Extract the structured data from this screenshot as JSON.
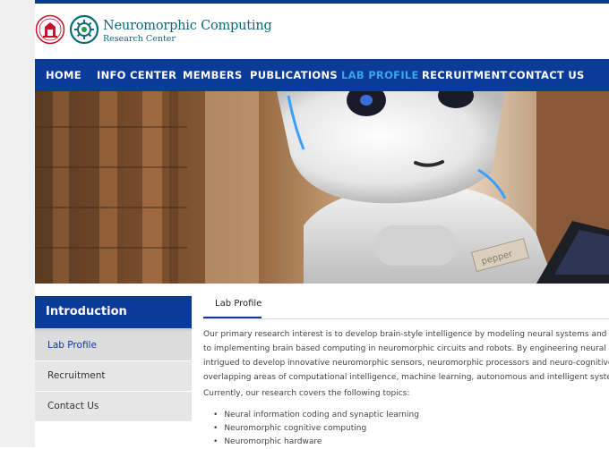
{
  "brand": {
    "title": "Neuromorphic Computing",
    "subtitle": "Research Center"
  },
  "nav": {
    "items": [
      {
        "label": "HOME"
      },
      {
        "label": "INFO CENTER"
      },
      {
        "label": "MEMBERS"
      },
      {
        "label": "PUBLICATIONS"
      },
      {
        "label": "LAB PROFILE"
      },
      {
        "label": "RECRUITMENT"
      },
      {
        "label": "CONTACT US"
      }
    ],
    "active": "LAB PROFILE"
  },
  "hero": {
    "robot_name_tag": "pepper"
  },
  "sidebar": {
    "heading": "Introduction",
    "items": [
      {
        "label": "Lab Profile"
      },
      {
        "label": "Recruitment"
      },
      {
        "label": "Contact Us"
      }
    ],
    "active": "Lab Profile"
  },
  "content": {
    "tab": "Lab Profile",
    "paragraph_lines": [
      "Our primary research interest is to develop brain-style intelligence by modeling neural systems and cognitive",
      "to implementing brain based computing in neuromorphic circuits and robots. By engineering neural circuits of",
      "intrigued to develop innovative neuromorphic sensors, neuromorphic processors and neuro-cognitive robots.",
      "overlapping areas of computational intelligence, machine learning, autonomous and intelligent systems, etc."
    ],
    "topics_intro": "Currently, our research covers the following topics:",
    "topics": [
      "Neural information coding and synaptic learning",
      "Neuromorphic cognitive computing",
      "Neuromorphic hardware"
    ]
  },
  "colors": {
    "nav_bg": "#0b3b9a",
    "nav_active": "#3aa6e8",
    "brand_text": "#0a6a7a"
  }
}
